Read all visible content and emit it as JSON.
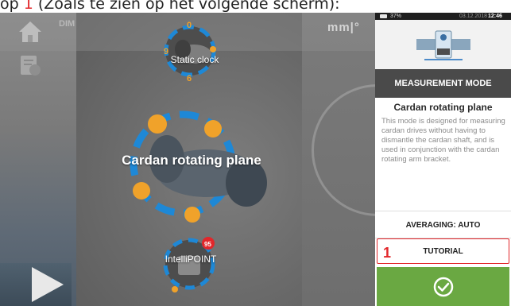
{
  "caption": {
    "prefix": "op ",
    "marker": "1",
    "suffix": " (Zoals te zien op het volgende scherm):"
  },
  "top_bar": {
    "dimension_label": "DIM",
    "units": "mm|°"
  },
  "modes": {
    "static_clock": "Static clock",
    "cardan_rotating_plane": "Cardan rotating plane",
    "intellipoint": "IntelliPOINT"
  },
  "status_bar": {
    "battery": "37%",
    "date": "03.12.2018",
    "time": "12:46"
  },
  "panel": {
    "header": "MEASUREMENT MODE",
    "mode_title": "Cardan rotating plane",
    "description": "This mode is designed for measuring cardan drives without having to dismantle the cardan shaft, and is used in conjunction with the cardan rotating arm bracket.",
    "averaging_label": "AVERAGING: AUTO",
    "tutorial_label": "TUTORIAL",
    "tutorial_marker": "1"
  },
  "colors": {
    "accent_red": "#e2262a",
    "confirm_green": "#6aa842",
    "header_dark": "#4a4a4a",
    "ring_blue": "#1e88d6",
    "sensor_orange": "#f0a22a"
  },
  "icons": [
    "home-icon",
    "document-icon",
    "clock-icon",
    "check-icon",
    "coupling-icon"
  ]
}
